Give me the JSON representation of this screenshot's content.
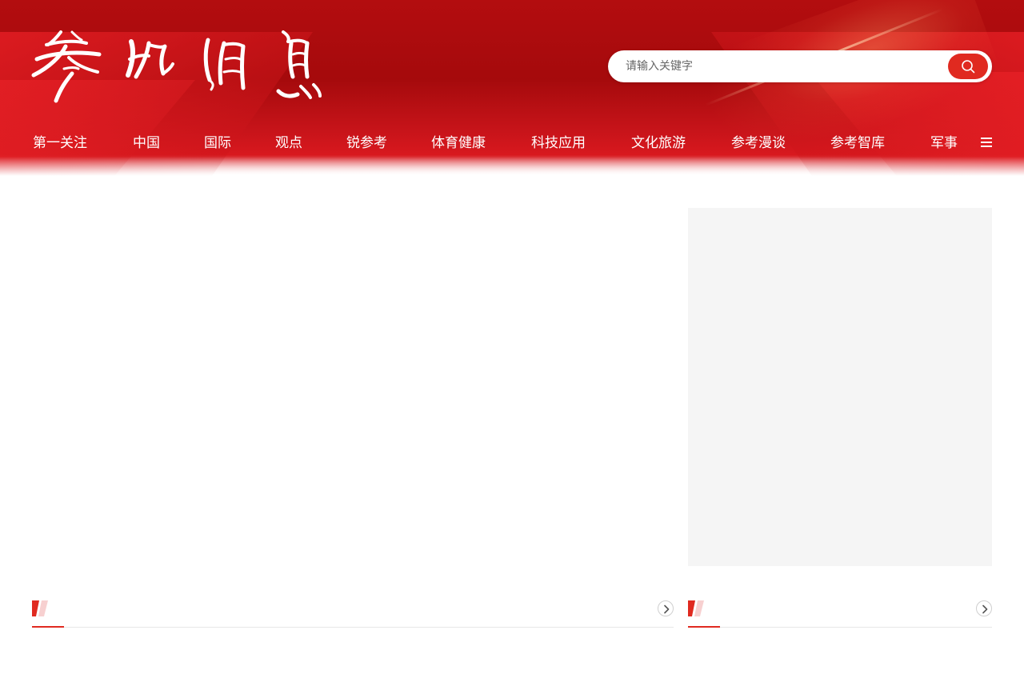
{
  "site": {
    "logo_text": "参考消息"
  },
  "search": {
    "placeholder": "请输入关键字",
    "button_icon": "search-icon"
  },
  "nav": {
    "items": [
      {
        "label": "第一关注"
      },
      {
        "label": "中国"
      },
      {
        "label": "国际"
      },
      {
        "label": "观点"
      },
      {
        "label": "锐参考"
      },
      {
        "label": "体育健康"
      },
      {
        "label": "科技应用"
      },
      {
        "label": "文化旅游"
      },
      {
        "label": "参考漫谈"
      },
      {
        "label": "参考智库"
      },
      {
        "label": "军事"
      }
    ],
    "menu_icon": "menu-icon"
  },
  "sections": {
    "left": {
      "more_icon": "chevron-right-icon"
    },
    "right": {
      "more_icon": "chevron-right-icon"
    }
  },
  "colors": {
    "brand_red": "#b30d0f",
    "accent_red": "#e02a20",
    "panel_bg": "#f5f5f5",
    "divider": "#e8e8e8"
  }
}
